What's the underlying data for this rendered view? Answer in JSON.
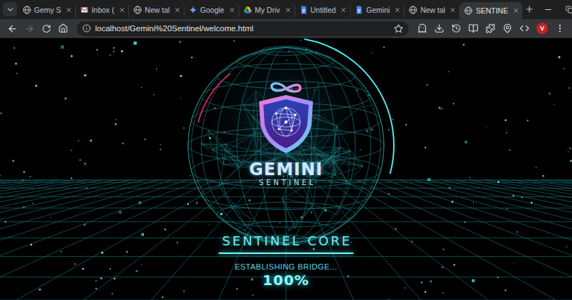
{
  "browser": {
    "tabs": [
      {
        "label": "Gemy S",
        "selected": false,
        "kind": "globe"
      },
      {
        "label": "Inbox (",
        "selected": false,
        "kind": "gmail"
      },
      {
        "label": "New tal",
        "selected": false,
        "kind": "globe"
      },
      {
        "label": "Google",
        "selected": false,
        "kind": "gemini"
      },
      {
        "label": "My Driv",
        "selected": false,
        "kind": "drive"
      },
      {
        "label": "Untitled",
        "selected": false,
        "kind": "docs"
      },
      {
        "label": "Gemini",
        "selected": false,
        "kind": "docs"
      },
      {
        "label": "New tal",
        "selected": false,
        "kind": "globe"
      },
      {
        "label": "SENTINE",
        "selected": true,
        "kind": "globe"
      }
    ],
    "address": "localhost/Gemini%20Sentinel/welcome.html",
    "back_enabled": true,
    "forward_enabled": false,
    "bookmarked": false,
    "profile": "V"
  },
  "page": {
    "logo": {
      "title": "GEMINI",
      "subtitle": "SENTINEL"
    },
    "heading": "SENTINEL CORE",
    "progress": {
      "label": "ESTABLISHING BRIDGE...",
      "reading": "100%",
      "level": 1
    }
  }
}
